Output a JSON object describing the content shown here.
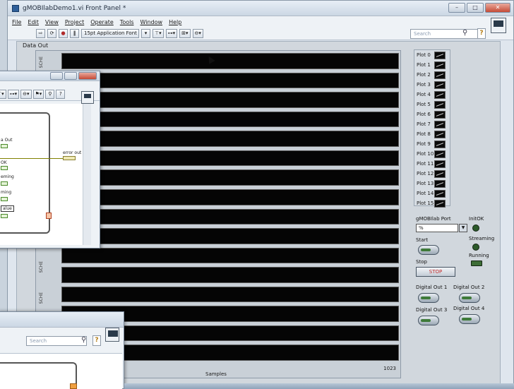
{
  "window": {
    "title": "gMOBIlabDemo1.vi Front Panel *",
    "menu": [
      "File",
      "Edit",
      "View",
      "Project",
      "Operate",
      "Tools",
      "Window",
      "Help"
    ],
    "toolbar": {
      "font_label": "15pt Application Font",
      "search_placeholder": "Search",
      "help_label": "?"
    }
  },
  "panel": {
    "graph_label": "Data Out",
    "y_axis_label": "SCHE",
    "x_axis_label": "Samples",
    "x_axis_end": "1023",
    "plots": [
      "Plot 0",
      "Plot 1",
      "Plot 2",
      "Plot 3",
      "Plot 4",
      "Plot 5",
      "Plot 6",
      "Plot 7",
      "Plot 8",
      "Plot 9",
      "Plot 10",
      "Plot 11",
      "Plot 12",
      "Plot 13",
      "Plot 14",
      "Plot 15"
    ],
    "controls": {
      "port_label": "gMOBIlab Port",
      "port_value": "%",
      "init_ok_label": "InitOK",
      "start_label": "Start",
      "streaming_label": "Streaming",
      "running_label": "Running",
      "stop_label": "Stop",
      "stop_button_text": "STOP",
      "digital_out_1": "Digital Out 1",
      "digital_out_2": "Digital Out 2",
      "digital_out_3": "Digital Out 3",
      "digital_out_4": "Digital Out 4"
    }
  },
  "block_diagram": {
    "labels": {
      "data_out": "a Out",
      "error_out": "error out",
      "init_ok": "OK",
      "streaming": "eming",
      "running": "ming",
      "value": "alue"
    }
  },
  "lower_window": {
    "search_placeholder": "Search",
    "help_label": "?"
  }
}
